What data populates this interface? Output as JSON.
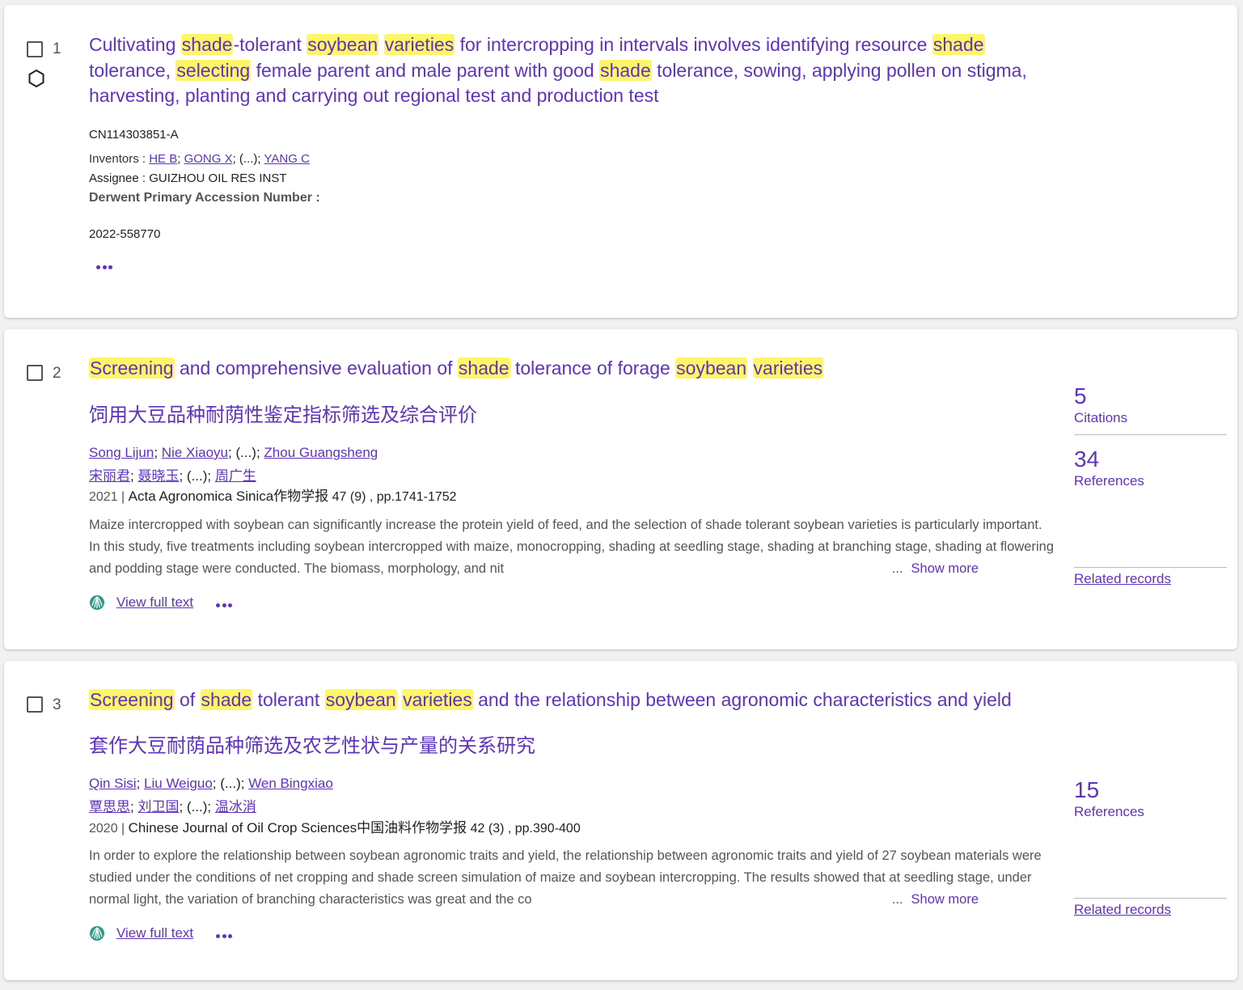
{
  "records": [
    {
      "index": "1",
      "title_segments": [
        {
          "t": "Cultivating "
        },
        {
          "t": "shade",
          "hl": true
        },
        {
          "t": "-tolerant "
        },
        {
          "t": "soybean",
          "hl": true
        },
        {
          "t": " "
        },
        {
          "t": "varieties",
          "hl": true
        },
        {
          "t": " for intercropping in intervals involves identifying resource "
        },
        {
          "t": "shade",
          "hl": true
        },
        {
          "t": " tolerance, "
        },
        {
          "t": "selecting",
          "hl": true
        },
        {
          "t": " female parent and male parent with good "
        },
        {
          "t": "shade",
          "hl": true
        },
        {
          "t": " tolerance, sowing, applying pollen on stigma, harvesting, planting and carrying out regional test and production test"
        }
      ],
      "patent_number": "CN114303851-A",
      "inventors_label": "Inventors : ",
      "inventors": [
        "HE B",
        "GONG X",
        "(...)",
        "YANG C"
      ],
      "assignee_label": "Assignee : ",
      "assignee": "GUIZHOU OIL RES INST",
      "accession_label": "Derwent Primary Accession Number :",
      "accession_number": "2022-558770",
      "icon": "hexagon-structure-icon"
    },
    {
      "index": "2",
      "title_segments": [
        {
          "t": "Screening",
          "hl": true
        },
        {
          "t": " and comprehensive evaluation of "
        },
        {
          "t": "shade",
          "hl": true
        },
        {
          "t": " tolerance of forage "
        },
        {
          "t": "soybean",
          "hl": true
        },
        {
          "t": " "
        },
        {
          "t": "varieties",
          "hl": true
        }
      ],
      "title_cn": "饲用大豆品种耐荫性鉴定指标筛选及综合评价",
      "authors": [
        "Song Lijun",
        "Nie Xiaoyu",
        "(...)",
        "Zhou Guangsheng"
      ],
      "authors_cn": [
        "宋丽君",
        "聂晓玉",
        "(...)",
        "周广生"
      ],
      "year": "2021",
      "journal": "Acta Agronomica Sinica作物学报",
      "volume": "47 (9) , pp.1741-1752",
      "abstract": "Maize intercropped with soybean can significantly increase the protein yield of feed, and the selection of shade tolerant soybean varieties is particularly important. In this study, five treatments including soybean intercropped with maize, monocropping, shading at seedling stage, shading at branching stage, shading at flowering and podding stage were conducted. The biomass, morphology, and nit",
      "ellipsis": "...",
      "show_more": "Show more",
      "view_full_text": "View full text",
      "metrics": [
        {
          "value": "5",
          "label": "Citations"
        },
        {
          "value": "34",
          "label": "References"
        }
      ],
      "related": "Related records"
    },
    {
      "index": "3",
      "title_segments": [
        {
          "t": "Screening",
          "hl": true
        },
        {
          "t": " of "
        },
        {
          "t": "shade",
          "hl": true
        },
        {
          "t": " tolerant "
        },
        {
          "t": "soybean",
          "hl": true
        },
        {
          "t": " "
        },
        {
          "t": "varieties",
          "hl": true
        },
        {
          "t": " and the relationship between agronomic characteristics and yield"
        }
      ],
      "title_cn": "套作大豆耐荫品种筛选及农艺性状与产量的关系研究",
      "authors": [
        "Qin Sisi",
        "Liu Weiguo",
        "(...)",
        "Wen Bingxiao"
      ],
      "authors_cn": [
        "覃思思",
        "刘卫国",
        "(...)",
        "温冰消"
      ],
      "year": "2020",
      "journal": "Chinese Journal of Oil Crop Sciences中国油料作物学报",
      "volume": "42 (3) , pp.390-400",
      "abstract": "In order to explore the relationship between soybean agronomic traits and yield, the relationship between agronomic traits and yield of 27 soybean materials were studied under the conditions of net cropping and shade screen simulation of maize and soybean intercropping. The results showed that at seedling stage, under normal light, the variation of branching characteristics was great and the co",
      "ellipsis": "...",
      "show_more": "Show more",
      "view_full_text": "View full text",
      "metrics": [
        {
          "value": "15",
          "label": "References"
        }
      ],
      "related": "Related records"
    }
  ],
  "colors": {
    "accent": "#5e33bf",
    "highlight": "#fff569"
  }
}
